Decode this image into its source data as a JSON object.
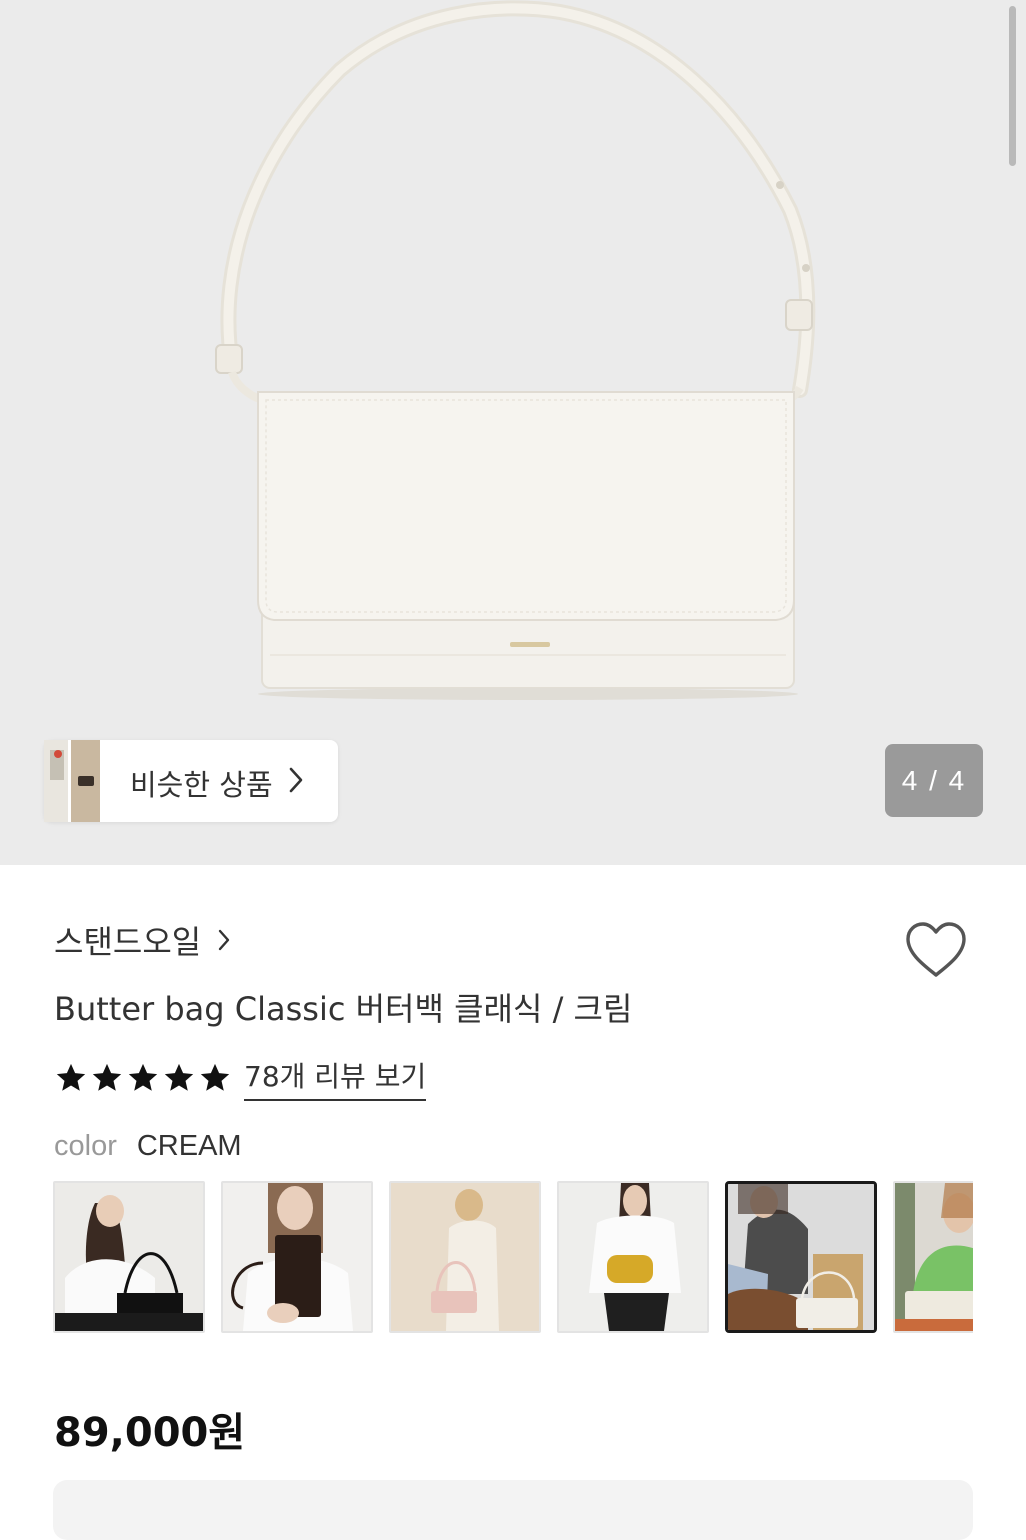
{
  "gallery": {
    "similar_button_label": "비슷한 상품",
    "counter": "4 / 4"
  },
  "product": {
    "brand": "스탠드오일",
    "title": "Butter bag Classic 버터백 클래식 / 크림",
    "rating_stars": 5,
    "review_link": "78개 리뷰 보기",
    "color_label": "color",
    "color_value": "CREAM",
    "swatches": [
      {
        "name": "black",
        "selected": false
      },
      {
        "name": "dark-brown",
        "selected": false
      },
      {
        "name": "pink",
        "selected": false
      },
      {
        "name": "yellow",
        "selected": false
      },
      {
        "name": "cream",
        "selected": true
      },
      {
        "name": "ivory",
        "selected": false
      }
    ],
    "price": "89,000원"
  },
  "colors": {
    "hero_bg": "#ebebeb",
    "counter_bg": "#9a9a9a",
    "text_primary": "#333333",
    "text_muted": "#999999"
  }
}
